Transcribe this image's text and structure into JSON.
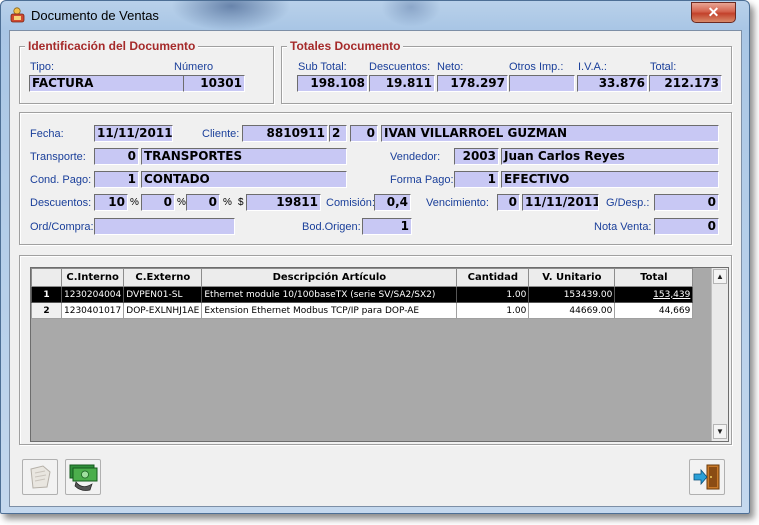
{
  "window": {
    "title": "Documento de Ventas",
    "close_glyph": "✕"
  },
  "ident": {
    "title": "Identificación del Documento",
    "tipo_label": "Tipo:",
    "numero_label": "Número",
    "tipo": "FACTURA",
    "numero": "10301"
  },
  "totales": {
    "title": "Totales Documento",
    "sub_total_label": "Sub Total:",
    "descuentos_label": "Descuentos:",
    "neto_label": "Neto:",
    "otros_label": "Otros Imp.:",
    "iva_label": "I.V.A.:",
    "total_label": "Total:",
    "sub_total": "198.108",
    "descuentos": "19.811",
    "neto": "178.297",
    "otros": "",
    "iva": "33.876",
    "total": "212.173"
  },
  "form": {
    "fecha_label": "Fecha:",
    "fecha": "11/11/2011",
    "cliente_label": "Cliente:",
    "cliente_rut": "8810911",
    "cliente_dv": "2",
    "cliente_suc": "0",
    "cliente_nombre": "IVAN VILLARROEL GUZMAN",
    "transporte_label": "Transporte:",
    "transporte_cod": "0",
    "transporte_nombre": "TRANSPORTES",
    "vendedor_label": "Vendedor:",
    "vendedor_cod": "2003",
    "vendedor_nombre": "Juan Carlos Reyes",
    "cond_pago_label": "Cond. Pago:",
    "cond_pago_cod": "1",
    "cond_pago_nombre": "CONTADO",
    "forma_pago_label": "Forma Pago:",
    "forma_pago_cod": "1",
    "forma_pago_nombre": "EFECTIVO",
    "descuentos_label": "Descuentos:",
    "desc1": "10",
    "desc2": "0",
    "desc3": "0",
    "pct": "%",
    "dollar": "$",
    "desc_monto": "19811",
    "comision_label": "Comisión:",
    "comision": "0,4",
    "vencimiento_label": "Vencimiento:",
    "venc_dias": "0",
    "venc_fecha": "11/11/2011",
    "gdesp_label": "G/Desp.:",
    "gdesp": "0",
    "ord_compra_label": "Ord/Compra:",
    "ord_compra": "",
    "bod_origen_label": "Bod.Origen:",
    "bod_origen": "1",
    "nota_venta_label": "Nota Venta:",
    "nota_venta": "0"
  },
  "grid": {
    "columns": [
      "C.Interno",
      "C.Externo",
      "Descripción Artículo",
      "Cantidad",
      "V. Unitario",
      "Total"
    ],
    "rows": [
      {
        "n": "1",
        "c_interno": "1230204004",
        "c_externo": "DVPEN01-SL",
        "descripcion": "Ethernet module 10/100baseTX (serie SV/SA2/SX2)",
        "cantidad": "1.00",
        "v_unitario": "153439.00",
        "total": "153,439"
      },
      {
        "n": "2",
        "c_interno": "1230401017",
        "c_externo": "DOP-EXLNHJ1AE",
        "descripcion": "Extension Ethernet Modbus TCP/IP para DOP-AE",
        "cantidad": "1.00",
        "v_unitario": "44669.00",
        "total": "44,669"
      }
    ],
    "scroll_up": "▲",
    "scroll_down": "▼"
  },
  "toolbar": {
    "icons": [
      "document-icon",
      "money-icon",
      "exit-icon"
    ]
  },
  "colors": {
    "field_bg": "#c8c8f4",
    "label": "#1a3f9a",
    "group_title": "#a52a2a"
  }
}
